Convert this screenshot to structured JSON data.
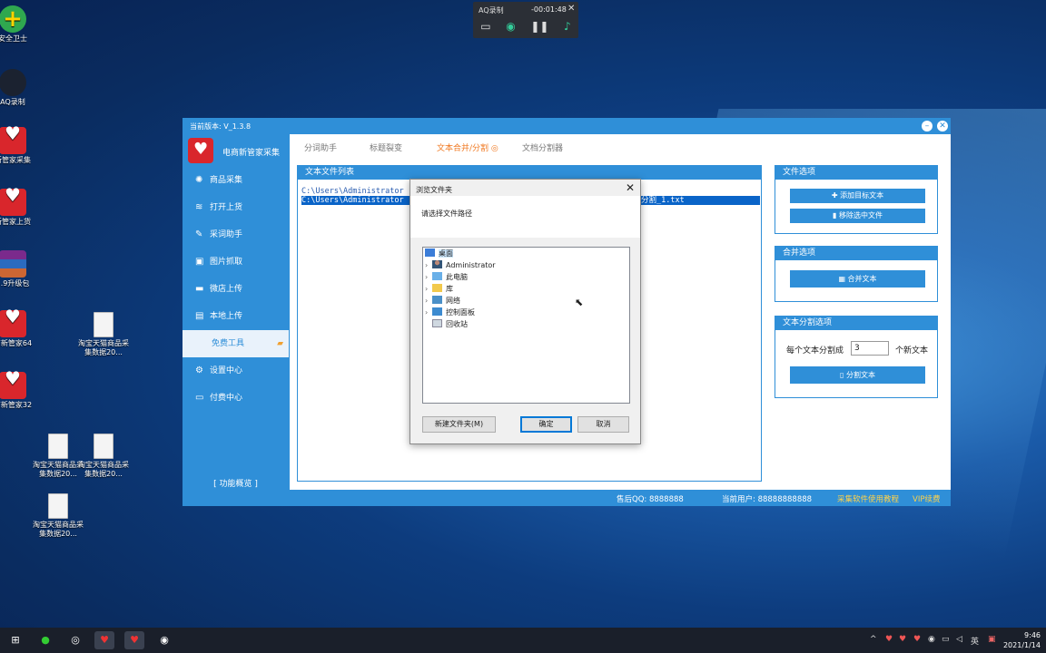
{
  "desktop": {
    "icons": [
      {
        "label": "安全卫士"
      },
      {
        "label": "AQ录制"
      },
      {
        "label": "新管家采集"
      },
      {
        "label": "新管家上货"
      },
      {
        "label": "5.9升级包"
      },
      {
        "label": "商新管家64"
      },
      {
        "label": "淘宝天猫商品采集数据20..."
      },
      {
        "label": "商新管家32"
      },
      {
        "label": "淘宝天猫商品采集数据20..."
      },
      {
        "label": "淘宝天猫商品采集数据20..."
      },
      {
        "label": "淘宝天猫商品采集数据20..."
      }
    ]
  },
  "recorder": {
    "name": "AQ录制",
    "time": "-00:01:48"
  },
  "app": {
    "version": "当前版本: V_1.3.8",
    "name": "电商新管家采集",
    "nav": [
      {
        "label": "商品采集",
        "icon": "spider-icon"
      },
      {
        "label": "打开上货",
        "icon": "upload-icon"
      },
      {
        "label": "采词助手",
        "icon": "edit-icon"
      },
      {
        "label": "图片抓取",
        "icon": "image-icon"
      },
      {
        "label": "微店上传",
        "icon": "store-icon"
      },
      {
        "label": "本地上传",
        "icon": "upload-icon"
      },
      {
        "label": "免费工具",
        "icon": "briefcase-icon"
      },
      {
        "label": "设置中心",
        "icon": "gear-icon"
      },
      {
        "label": "付费中心",
        "icon": "card-icon"
      }
    ],
    "feature_link": "[ 功能概览 ]",
    "tabs": [
      "分词助手",
      "标题裂变",
      "文本合并/分割",
      "文档分割器"
    ],
    "active_tab": 2,
    "file_list_title": "文本文件列表",
    "files": [
      "C:\\Users\\Administrator",
      "C:\\Users\\Administrator"
    ],
    "file_suffix": "分割_1.txt",
    "file_options_title": "文件选项",
    "add_button": "添加目标文本",
    "remove_button": "移除选中文件",
    "merge_title": "合并选项",
    "merge_button": "合并文本",
    "split_title": "文本分割选项",
    "split_prefix": "每个文本分割成",
    "split_value": "3",
    "split_suffix": "个新文本",
    "split_button": "分割文本",
    "status": {
      "qq": "售后QQ: 8888888",
      "user": "当前用户: 88888888888",
      "tutorial": "采集软件使用教程",
      "vip": "VIP续费"
    }
  },
  "dialog": {
    "title": "浏览文件夹",
    "hint": "请选择文件路径",
    "tree": [
      {
        "label": "桌面",
        "selected": true
      },
      {
        "label": "Administrator"
      },
      {
        "label": "此电脑"
      },
      {
        "label": "库"
      },
      {
        "label": "网络"
      },
      {
        "label": "控制面板"
      },
      {
        "label": "回收站"
      }
    ],
    "new_folder": "新建文件夹(M)",
    "ok": "确定",
    "cancel": "取消"
  },
  "taskbar": {
    "lang": "英",
    "time": "9:46",
    "date": "2021/1/14"
  },
  "colors": {
    "accent": "#2f8fd8",
    "tab_active": "#f07820",
    "status_link": "#ffd24a"
  }
}
